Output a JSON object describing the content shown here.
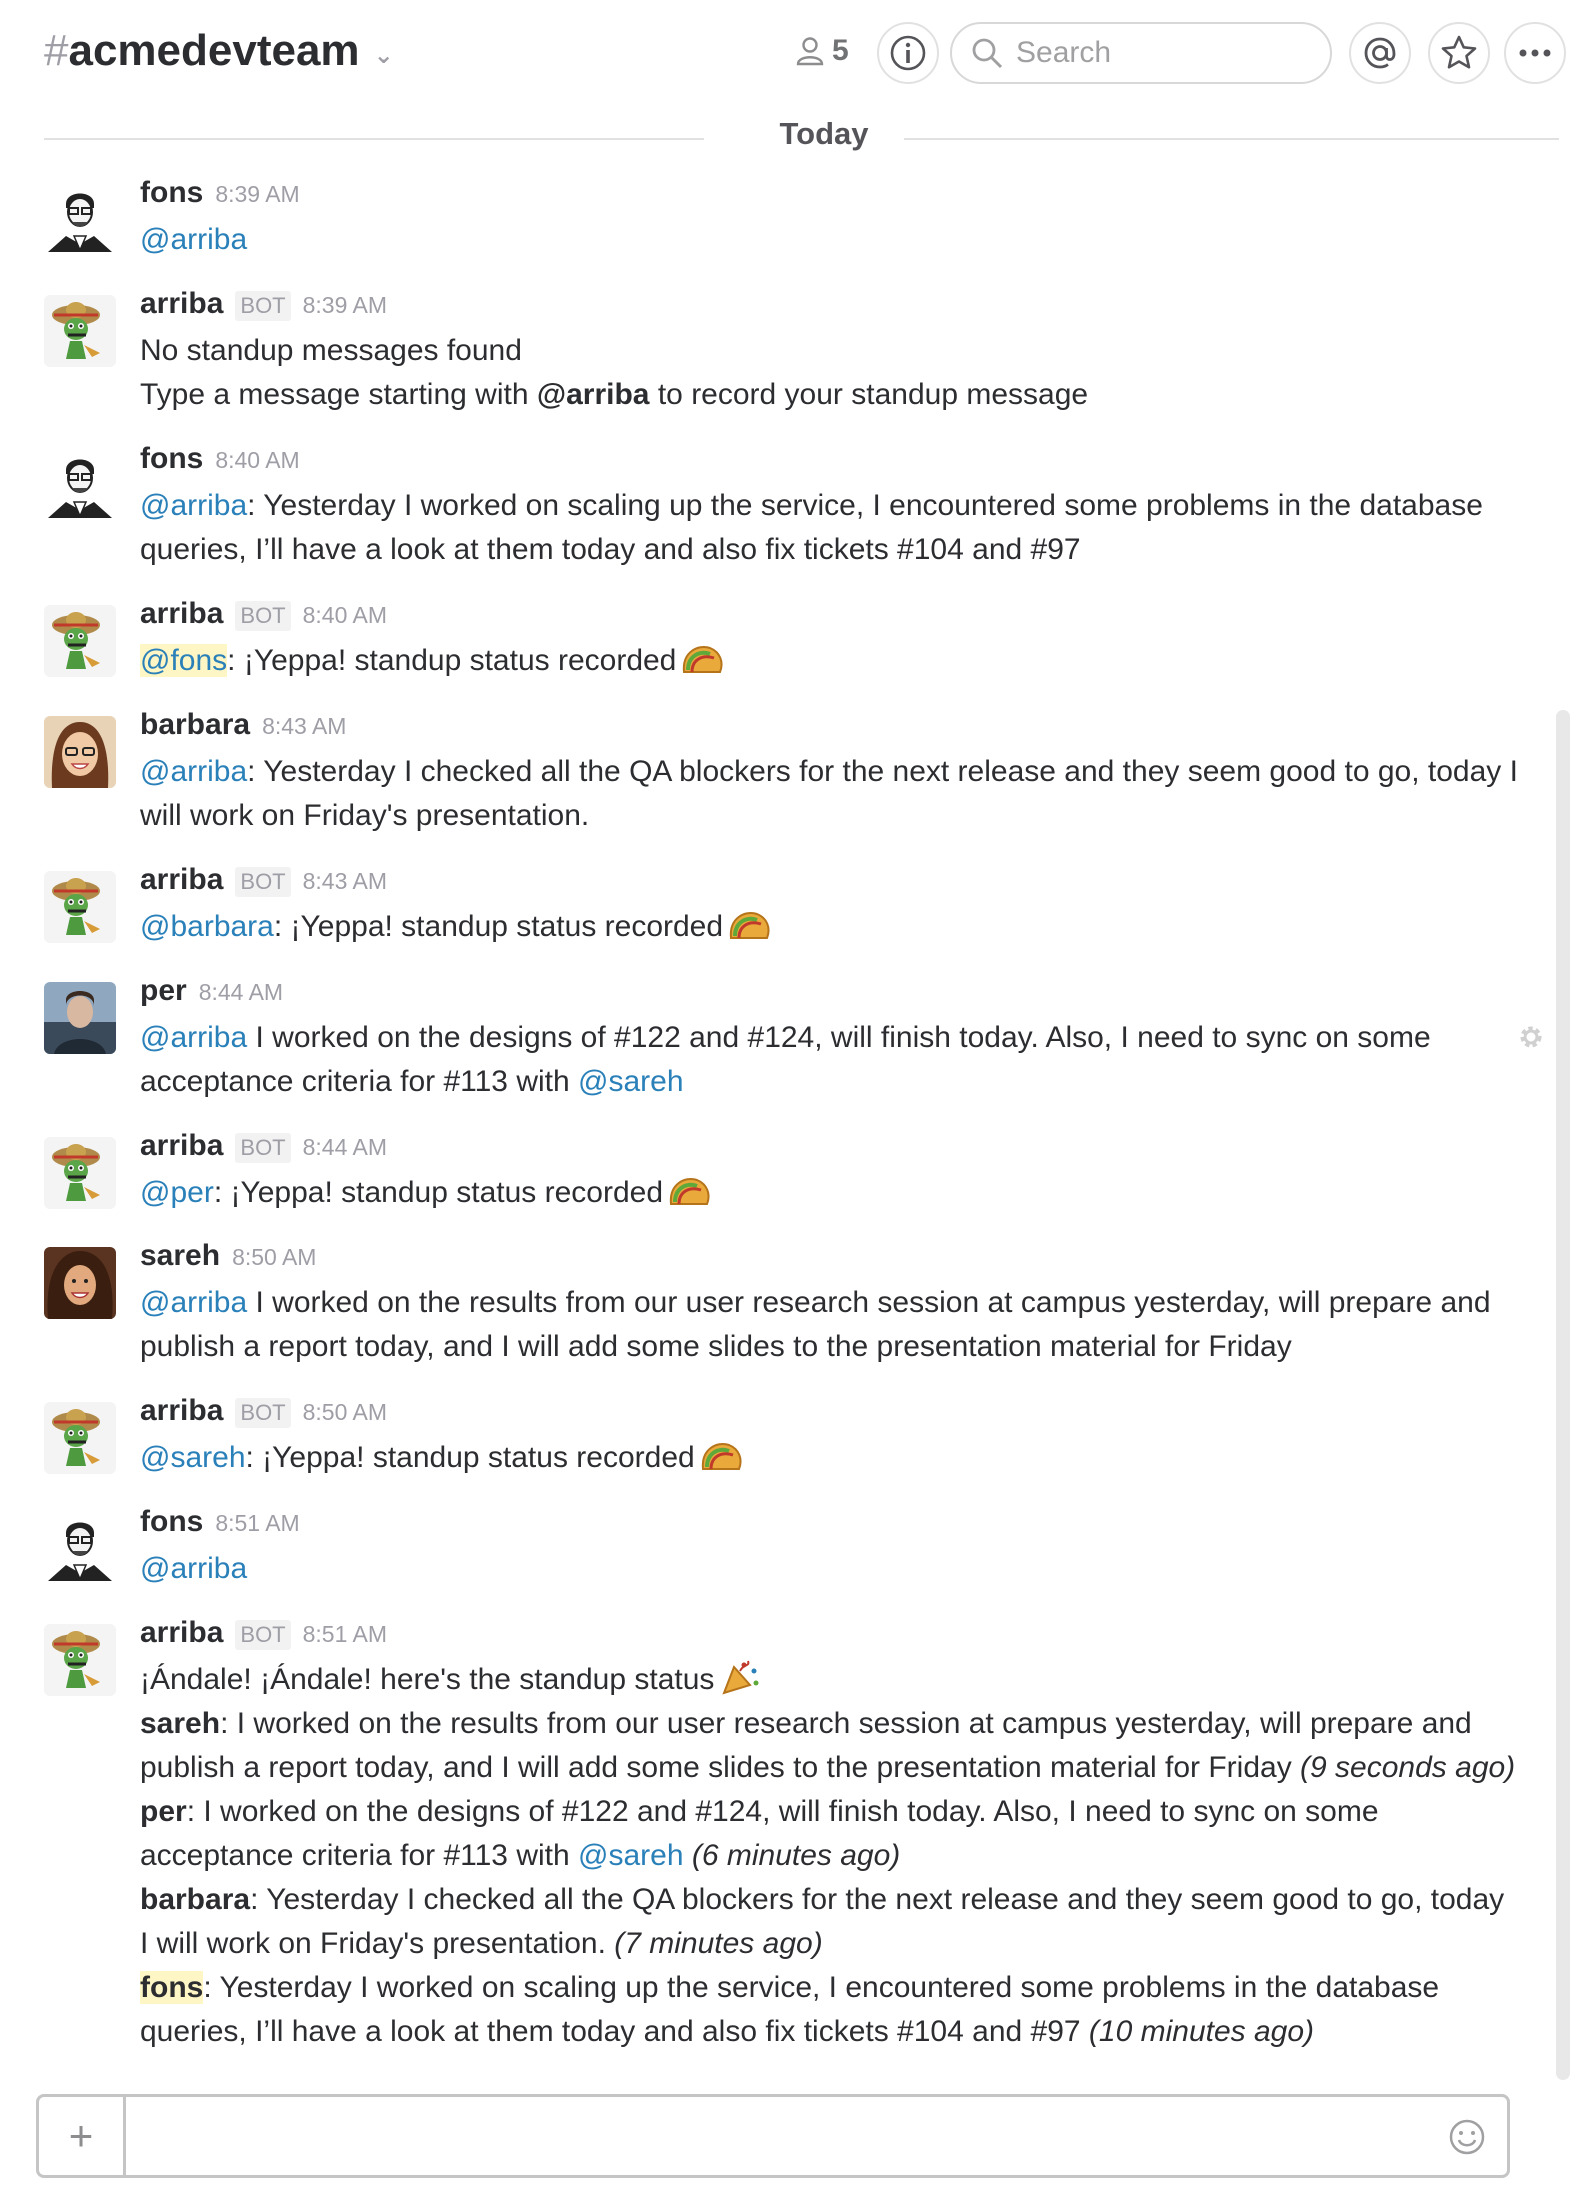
{
  "header": {
    "channel_hash": "#",
    "channel_name": "acmedevteam",
    "member_count": "5",
    "search_placeholder": "Search"
  },
  "divider_label": "Today",
  "messages": [
    {
      "author": "fons",
      "time": "8:39 AM",
      "bot": false,
      "lines": {
        "mention": "@arriba"
      }
    },
    {
      "author": "arriba",
      "time": "8:39 AM",
      "bot": true,
      "bot_label": "BOT",
      "lines": {
        "l1": "No standup messages found",
        "l2a": "Type a message starting with ",
        "l2b": "@arriba",
        "l2c": " to record your standup message"
      }
    },
    {
      "author": "fons",
      "time": "8:40 AM",
      "bot": false,
      "lines": {
        "mention": "@arriba",
        "text": ": Yesterday I worked on scaling up the service, I encountered some problems in the database queries, I’ll have a look at them today and also fix tickets #104 and #97"
      }
    },
    {
      "author": "arriba",
      "time": "8:40 AM",
      "bot": true,
      "bot_label": "BOT",
      "lines": {
        "mention": "@fons",
        "text": ": ¡Yeppa! standup status recorded"
      }
    },
    {
      "author": "barbara",
      "time": "8:43 AM",
      "bot": false,
      "lines": {
        "mention": "@arriba",
        "text": ": Yesterday I checked all the QA blockers for the next release and they seem good to go, today I will work on Friday's presentation."
      }
    },
    {
      "author": "arriba",
      "time": "8:43 AM",
      "bot": true,
      "bot_label": "BOT",
      "lines": {
        "mention": "@barbara",
        "text": ": ¡Yeppa! standup status recorded"
      }
    },
    {
      "author": "per",
      "time": "8:44 AM",
      "bot": false,
      "lines": {
        "mention": "@arriba",
        "text": " I worked on the designs of #122 and #124, will finish today. Also, I need to sync on some acceptance criteria for #113 with ",
        "mention2": "@sareh"
      }
    },
    {
      "author": "arriba",
      "time": "8:44 AM",
      "bot": true,
      "bot_label": "BOT",
      "lines": {
        "mention": "@per",
        "text": ": ¡Yeppa! standup status recorded"
      }
    },
    {
      "author": "sareh",
      "time": "8:50 AM",
      "bot": false,
      "lines": {
        "mention": "@arriba",
        "text": " I worked on the results from our user research session at campus yesterday, will prepare and publish a report today, and I will add some slides to the presentation material for Friday"
      }
    },
    {
      "author": "arriba",
      "time": "8:50 AM",
      "bot": true,
      "bot_label": "BOT",
      "lines": {
        "mention": "@sareh",
        "text": ": ¡Yeppa! standup status recorded"
      }
    },
    {
      "author": "fons",
      "time": "8:51 AM",
      "bot": false,
      "lines": {
        "mention": "@arriba"
      }
    },
    {
      "author": "arriba",
      "time": "8:51 AM",
      "bot": true,
      "bot_label": "BOT",
      "lines": {
        "intro": "¡Ándale! ¡Ándale! here's the standup status",
        "s1_name": "sareh",
        "s1_text": ": I worked on the results from our user research session at campus yesterday, will prepare and publish a report today, and I will add some slides to the presentation material for Friday ",
        "s1_ago": "(9 seconds ago)",
        "s2_name": "per",
        "s2_text": ": I worked on the designs of #122 and #124, will finish today. Also, I need to sync on some acceptance criteria for #113 with ",
        "s2_mention": "@sareh",
        "s2_ago": " (6 minutes ago)",
        "s3_name": "barbara",
        "s3_text": ": Yesterday I checked all the QA blockers for the next release and they seem good to go, today I will work on Friday's presentation. ",
        "s3_ago": "(7 minutes ago)",
        "s4_name": "fons",
        "s4_text": ": Yesterday I worked on scaling up the service, I encountered some problems in the database queries, I’ll have a look at them today and also fix tickets #104 and #97 ",
        "s4_ago": "(10 minutes ago)"
      }
    }
  ],
  "composer": {
    "plus": "+",
    "placeholder": ""
  },
  "icons": {
    "members": "person-icon",
    "info": "info-icon",
    "search": "search-icon",
    "mentions": "at-icon",
    "starred": "star-icon",
    "more": "more-icon",
    "emoji": "emoji-icon",
    "taco": "taco-icon",
    "party": "party-popper-icon",
    "gear": "gear-icon"
  }
}
